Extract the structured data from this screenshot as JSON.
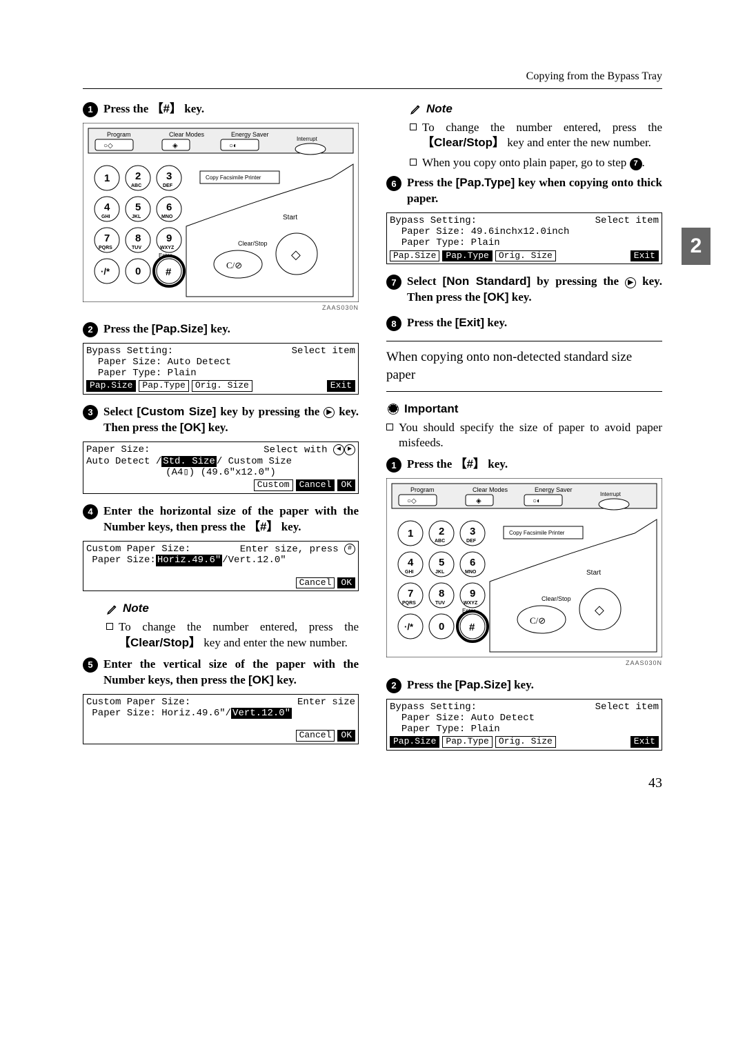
{
  "header": {
    "title": "Copying from the Bypass Tray"
  },
  "sideTab": "2",
  "pageNumber": "43",
  "kpCaption": "ZAAS030N",
  "left": {
    "s1": {
      "text": "Press the ",
      "key": "【#】",
      "tail": " key."
    },
    "s2": {
      "text": "Press the ",
      "key": "[Pap.Size]",
      "tail": " key."
    },
    "lcd1": {
      "l1a": "Bypass Setting:",
      "l1b": "Select item",
      "l2": "Paper Size: Auto Detect",
      "l3": "Paper Type: Plain",
      "btns": [
        "Pap.Size",
        "Pap.Type",
        "Orig. Size",
        "Exit"
      ]
    },
    "s3a": "Select ",
    "s3key1": "[Custom Size]",
    "s3b": " key by pressing the ",
    "s3c": " key. Then press the ",
    "s3key2": "[OK]",
    "s3d": " key.",
    "lcd2": {
      "l1a": "Paper Size:",
      "l1b": "Select with ",
      "l2a": "Auto Detect / ",
      "l2sel": "Std. Size",
      "l2b": " / Custom Size",
      "l3": "(A4▯)     (49.6\"x12.0\")",
      "btns": [
        "Custom",
        "Cancel",
        "OK"
      ]
    },
    "s4a": " Enter the horizontal size of the paper with the Number keys, then press the ",
    "s4key": "【#】",
    "s4b": " key.",
    "lcd3": {
      "l1a": "Custom Paper Size:",
      "l1b": "Enter size, press ",
      "l2a": "Paper Size: ",
      "l2sel": "Horiz.49.6\"",
      "l2b": "/Vert.12.0\"",
      "btns": [
        "Cancel",
        "OK"
      ]
    },
    "noteLabel": "Note",
    "note1a": "To change the number entered, press the ",
    "note1key": "【Clear/Stop】",
    "note1b": " key and enter the new number.",
    "s5a": "Enter the vertical size of the paper with the Number keys, then press the ",
    "s5key": "[OK]",
    "s5b": " key.",
    "lcd4": {
      "l1a": "Custom Paper Size:",
      "l1b": "Enter size",
      "l2a": "Paper Size: Horiz.49.6\"/",
      "l2sel": "Vert.12.0\"",
      "btns": [
        "Cancel",
        "OK"
      ]
    }
  },
  "right": {
    "noteLabel": "Note",
    "n1a": "To change the number entered, press the ",
    "n1key": "【Clear/Stop】",
    "n1b": " key and enter the new number.",
    "n2a": "When you copy onto plain paper, go to step ",
    "n2b": ".",
    "s6a": "Press the ",
    "s6key": "[Pap.Type]",
    "s6b": " key when copying onto thick paper.",
    "lcd5": {
      "l1a": "Bypass Setting:",
      "l1b": "Select item",
      "l2": "Paper Size: 49.6inchx12.0inch",
      "l3": "Paper Type: Plain",
      "btns": [
        "Pap.Size",
        "Pap.Type",
        "Orig. Size",
        "Exit"
      ]
    },
    "s7a": "Select ",
    "s7key1": "[Non Standard]",
    "s7b": " by pressing the ",
    "s7c": " key. Then press the ",
    "s7key2": "[OK]",
    "s7d": " key.",
    "s8a": "Press the ",
    "s8key": "[Exit]",
    "s8b": " key.",
    "section": "When copying onto non-detected standard size paper",
    "importantLabel": "Important",
    "imp": "You should specify the size of paper to avoid paper misfeeds.",
    "s1b": {
      "text": "Press the ",
      "key": "【#】",
      "tail": " key."
    },
    "s2b": {
      "text": "Press the ",
      "key": "[Pap.Size]",
      "tail": " key."
    },
    "lcd6": {
      "l1a": "Bypass Setting:",
      "l1b": "Select item",
      "l2": "Paper Size: Auto Detect",
      "l3": "Paper Type: Plain",
      "btns": [
        "Pap.Size",
        "Pap.Type",
        "Orig. Size",
        "Exit"
      ]
    }
  }
}
